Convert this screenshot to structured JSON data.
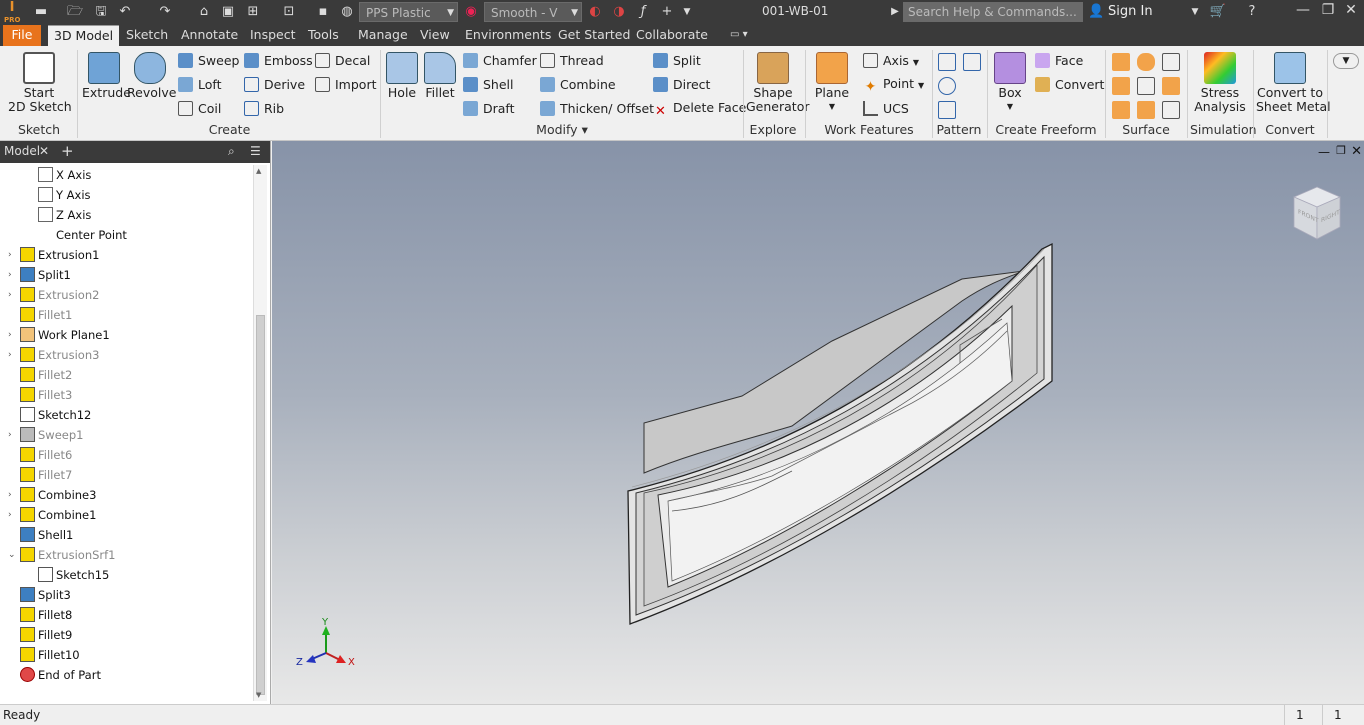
{
  "app": {
    "doc_title": "001-WB-01",
    "logo_text": "I",
    "logo_sub": "PRO"
  },
  "qat": {
    "material": "PPS Plastic",
    "appearance": "Smooth - V",
    "search_placeholder": "Search Help & Commands...",
    "sign_in": "Sign In"
  },
  "tabs": [
    "File",
    "3D Model",
    "Sketch",
    "Annotate",
    "Inspect",
    "Tools",
    "Manage",
    "View",
    "Environments",
    "Get Started",
    "Collaborate"
  ],
  "ribbon": {
    "sketch": {
      "start_line1": "Start",
      "start_line2": "2D Sketch",
      "group": "Sketch"
    },
    "create": {
      "extrude": "Extrude",
      "revolve": "Revolve",
      "sweep": "Sweep",
      "loft": "Loft",
      "coil": "Coil",
      "emboss": "Emboss",
      "derive": "Derive",
      "rib": "Rib",
      "decal": "Decal",
      "import": "Import",
      "group": "Create"
    },
    "modify": {
      "hole": "Hole",
      "fillet": "Fillet",
      "chamfer": "Chamfer",
      "shell": "Shell",
      "draft": "Draft",
      "thread": "Thread",
      "combine": "Combine",
      "thicken": "Thicken/ Offset",
      "split": "Split",
      "direct": "Direct",
      "delete_face": "Delete Face",
      "group": "Modify"
    },
    "explore": {
      "shape_line1": "Shape",
      "shape_line2": "Generator",
      "group": "Explore"
    },
    "work": {
      "plane": "Plane",
      "axis": "Axis",
      "point": "Point",
      "ucs": "UCS",
      "group": "Work Features"
    },
    "pattern": {
      "group": "Pattern"
    },
    "freeform": {
      "box": "Box",
      "face": "Face",
      "convert": "Convert",
      "group": "Create Freeform"
    },
    "surface": {
      "group": "Surface"
    },
    "simulation": {
      "stress_line1": "Stress",
      "stress_line2": "Analysis",
      "group": "Simulation"
    },
    "convert": {
      "line1": "Convert to",
      "line2": "Sheet Metal",
      "group": "Convert"
    }
  },
  "browser": {
    "tab": "Model",
    "nodes": [
      {
        "label": "X Axis",
        "indent": 2,
        "expand": "",
        "dim": false,
        "icon": "axis-icon"
      },
      {
        "label": "Y Axis",
        "indent": 2,
        "expand": "",
        "dim": false,
        "icon": "axis-icon"
      },
      {
        "label": "Z Axis",
        "indent": 2,
        "expand": "",
        "dim": false,
        "icon": "axis-icon"
      },
      {
        "label": "Center Point",
        "indent": 2,
        "expand": "",
        "dim": false,
        "icon": "point-icon"
      },
      {
        "label": "Extrusion1",
        "indent": 1,
        "expand": "›",
        "dim": false,
        "icon": "extrude-icon"
      },
      {
        "label": "Split1",
        "indent": 1,
        "expand": "›",
        "dim": false,
        "icon": "split-icon"
      },
      {
        "label": "Extrusion2",
        "indent": 1,
        "expand": "›",
        "dim": true,
        "icon": "extrude-icon"
      },
      {
        "label": "Fillet1",
        "indent": 1,
        "expand": "",
        "dim": true,
        "icon": "fillet-icon"
      },
      {
        "label": "Work Plane1",
        "indent": 1,
        "expand": "›",
        "dim": false,
        "icon": "plane-icon"
      },
      {
        "label": "Extrusion3",
        "indent": 1,
        "expand": "›",
        "dim": true,
        "icon": "extrude-icon"
      },
      {
        "label": "Fillet2",
        "indent": 1,
        "expand": "",
        "dim": true,
        "icon": "fillet-icon"
      },
      {
        "label": "Fillet3",
        "indent": 1,
        "expand": "",
        "dim": true,
        "icon": "fillet-icon"
      },
      {
        "label": "Sketch12",
        "indent": 1,
        "expand": "",
        "dim": false,
        "icon": "sketch-icon"
      },
      {
        "label": "Sweep1",
        "indent": 1,
        "expand": "›",
        "dim": true,
        "icon": "sweep-icon"
      },
      {
        "label": "Fillet6",
        "indent": 1,
        "expand": "",
        "dim": true,
        "icon": "fillet-icon"
      },
      {
        "label": "Fillet7",
        "indent": 1,
        "expand": "",
        "dim": true,
        "icon": "fillet-icon"
      },
      {
        "label": "Combine3",
        "indent": 1,
        "expand": "›",
        "dim": false,
        "icon": "combine-icon"
      },
      {
        "label": "Combine1",
        "indent": 1,
        "expand": "›",
        "dim": false,
        "icon": "combine-icon"
      },
      {
        "label": "Shell1",
        "indent": 1,
        "expand": "",
        "dim": false,
        "icon": "shell-icon"
      },
      {
        "label": "ExtrusionSrf1",
        "indent": 1,
        "expand": "⌄",
        "dim": true,
        "icon": "extrude-icon"
      },
      {
        "label": "Sketch15",
        "indent": 2,
        "expand": "",
        "dim": false,
        "icon": "sketch-icon"
      },
      {
        "label": "Split3",
        "indent": 1,
        "expand": "",
        "dim": false,
        "icon": "split-icon"
      },
      {
        "label": "Fillet8",
        "indent": 1,
        "expand": "",
        "dim": false,
        "icon": "fillet-icon"
      },
      {
        "label": "Fillet9",
        "indent": 1,
        "expand": "",
        "dim": false,
        "icon": "fillet-icon"
      },
      {
        "label": "Fillet10",
        "indent": 1,
        "expand": "",
        "dim": false,
        "icon": "fillet-icon"
      },
      {
        "label": "End of Part",
        "indent": 1,
        "expand": "",
        "dim": false,
        "icon": "end-of-part-icon"
      }
    ]
  },
  "viewport": {
    "triad": {
      "x": "X",
      "y": "Y",
      "z": "Z"
    },
    "viewcube": {
      "front": "FRONT",
      "right": "RIGHT"
    }
  },
  "status": {
    "text": "Ready",
    "count1": "1",
    "count2": "1"
  },
  "colors": {
    "file_tab": "#e8731c",
    "dark_bar": "#3a3a3a",
    "accent_blue": "#3d7fc1",
    "feature_yellow": "#f5d600"
  }
}
